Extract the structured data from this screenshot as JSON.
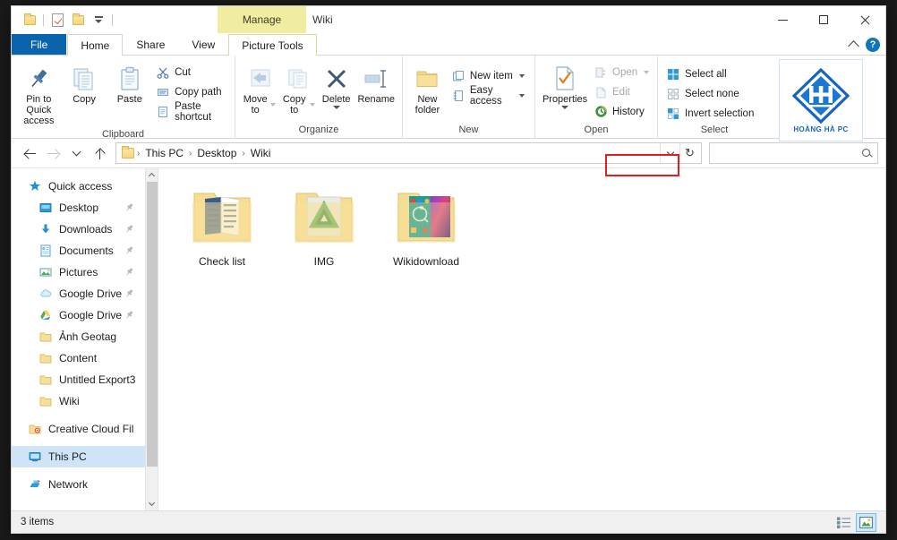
{
  "window": {
    "title": "Wiki",
    "contextual_tab_header": "Manage",
    "controls": {
      "minimize": "minimize-button",
      "maximize": "maximize-button",
      "close": "close-button"
    }
  },
  "quick_access_toolbar": {
    "items": [
      {
        "name": "folder-icon",
        "label": "Folder"
      },
      {
        "name": "properties-icon",
        "label": "Properties"
      },
      {
        "name": "new-folder-icon",
        "label": "New folder"
      },
      {
        "name": "customize-caret-icon",
        "label": "Customize Quick Access Toolbar"
      }
    ]
  },
  "tabs": [
    {
      "label": "File",
      "state": "file"
    },
    {
      "label": "Home",
      "state": "active"
    },
    {
      "label": "Share",
      "state": "normal"
    },
    {
      "label": "View",
      "state": "normal"
    },
    {
      "label": "Picture Tools",
      "state": "contextual"
    }
  ],
  "ribbon_controls": {
    "collapse": "chevron-up-icon",
    "help": "?"
  },
  "ribbon": {
    "groups": [
      {
        "label": "Clipboard",
        "big_buttons": [
          {
            "label": "Pin to Quick access",
            "icon": "pin-icon",
            "enabled": true
          },
          {
            "label": "Copy",
            "icon": "copy-icon",
            "enabled": true
          },
          {
            "label": "Paste",
            "icon": "paste-icon",
            "enabled": true
          }
        ],
        "small_buttons": [
          {
            "label": "Cut",
            "icon": "scissors-icon",
            "enabled": true
          },
          {
            "label": "Copy path",
            "icon": "copy-path-icon",
            "enabled": true
          },
          {
            "label": "Paste shortcut",
            "icon": "paste-shortcut-icon",
            "enabled": true
          }
        ]
      },
      {
        "label": "Organize",
        "big_buttons": [
          {
            "label": "Move to",
            "icon": "move-to-icon",
            "enabled": false,
            "has_caret": true
          },
          {
            "label": "Copy to",
            "icon": "copy-to-icon",
            "enabled": false,
            "has_caret": true
          },
          {
            "label": "Delete",
            "icon": "delete-x-icon",
            "enabled": true,
            "has_caret": true
          },
          {
            "label": "Rename",
            "icon": "rename-icon",
            "enabled": false
          }
        ]
      },
      {
        "label": "New",
        "big_buttons": [
          {
            "label": "New folder",
            "icon": "new-folder-icon",
            "enabled": true
          }
        ],
        "small_buttons": [
          {
            "label": "New item",
            "icon": "new-item-icon",
            "enabled": true,
            "has_caret": true
          },
          {
            "label": "Easy access",
            "icon": "easy-access-icon",
            "enabled": true,
            "has_caret": true
          }
        ]
      },
      {
        "label": "Open",
        "big_buttons": [
          {
            "label": "Properties",
            "icon": "properties-icon",
            "enabled": true,
            "has_caret": true
          }
        ],
        "small_buttons": [
          {
            "label": "Open",
            "icon": "open-icon",
            "enabled": false,
            "has_caret": true
          },
          {
            "label": "Edit",
            "icon": "edit-icon",
            "enabled": false
          },
          {
            "label": "History",
            "icon": "history-icon",
            "enabled": true,
            "highlighted": true
          }
        ]
      },
      {
        "label": "Select",
        "small_buttons": [
          {
            "label": "Select all",
            "icon": "select-all-icon",
            "enabled": true
          },
          {
            "label": "Select none",
            "icon": "select-none-icon",
            "enabled": true
          },
          {
            "label": "Invert selection",
            "icon": "invert-selection-icon",
            "enabled": true
          }
        ]
      }
    ],
    "highlight_color": "#e02020",
    "highlighted_button": "History"
  },
  "brand_logo": {
    "mark": "HH",
    "text": "HOÀNG HÀ PC",
    "color": "#1565c0"
  },
  "address_bar": {
    "back": "back-arrow-icon",
    "forward": "forward-arrow-icon",
    "recent": "recent-locations-icon",
    "up": "up-arrow-icon",
    "breadcrumb": [
      "This PC",
      "Desktop",
      "Wiki"
    ],
    "breadcrumb_separator": "›",
    "dropdown": "chevron-down-icon",
    "refresh": "refresh-icon",
    "search": {
      "value": "",
      "placeholder": "",
      "icon": "search-icon"
    }
  },
  "nav_pane": {
    "items": [
      {
        "label": "Quick access",
        "icon": "star-icon",
        "indent": false,
        "pinned": false,
        "selected": false
      },
      {
        "label": "Desktop",
        "icon": "desktop-icon",
        "indent": true,
        "pinned": true,
        "selected": false
      },
      {
        "label": "Downloads",
        "icon": "downloads-icon",
        "indent": true,
        "pinned": true,
        "selected": false
      },
      {
        "label": "Documents",
        "icon": "documents-icon",
        "indent": true,
        "pinned": true,
        "selected": false
      },
      {
        "label": "Pictures",
        "icon": "pictures-icon",
        "indent": true,
        "pinned": true,
        "selected": false
      },
      {
        "label": "Google Drive",
        "icon": "google-drive-cloud-icon",
        "indent": true,
        "pinned": true,
        "selected": false
      },
      {
        "label": "Google Drive",
        "icon": "google-drive-icon",
        "indent": true,
        "pinned": true,
        "selected": false
      },
      {
        "label": "Ảnh Geotag",
        "icon": "folder-icon",
        "indent": true,
        "pinned": false,
        "selected": false
      },
      {
        "label": "Content",
        "icon": "folder-icon",
        "indent": true,
        "pinned": false,
        "selected": false
      },
      {
        "label": "Untitled Export3",
        "icon": "folder-icon",
        "indent": true,
        "pinned": false,
        "selected": false
      },
      {
        "label": "Wiki",
        "icon": "folder-icon",
        "indent": true,
        "pinned": false,
        "selected": false
      },
      {
        "label": "Creative Cloud Fil",
        "icon": "creative-cloud-icon",
        "indent": false,
        "pinned": false,
        "selected": false,
        "gap_before": true
      },
      {
        "label": "This PC",
        "icon": "this-pc-icon",
        "indent": false,
        "pinned": false,
        "selected": true,
        "gap_before": true
      },
      {
        "label": "Network",
        "icon": "network-icon",
        "indent": false,
        "pinned": false,
        "selected": false,
        "gap_before": true
      }
    ],
    "scrollbar": {
      "up": "scroll-up-icon",
      "down": "scroll-down-icon"
    }
  },
  "content": {
    "files": [
      {
        "name": "Check list",
        "type": "folder",
        "thumbnail": "document-list-thumbnail"
      },
      {
        "name": "IMG",
        "type": "folder",
        "thumbnail": "green-triangle-thumbnail"
      },
      {
        "name": "Wikidownload",
        "type": "folder",
        "thumbnail": "colorful-infographic-thumbnail"
      }
    ]
  },
  "status_bar": {
    "item_count": "3 items",
    "view_buttons": [
      {
        "name": "details-view-button",
        "active": false
      },
      {
        "name": "large-icons-view-button",
        "active": true
      }
    ]
  }
}
